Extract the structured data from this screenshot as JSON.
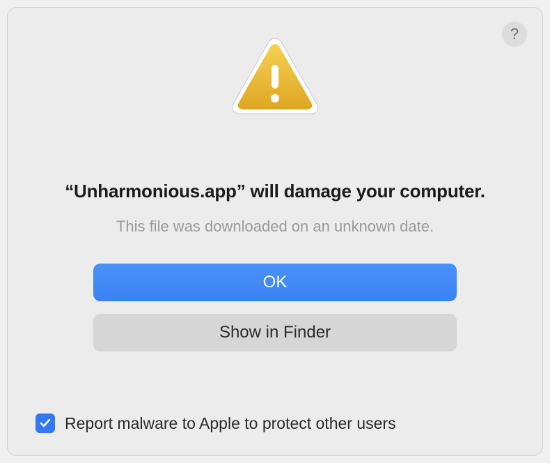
{
  "help_button": "?",
  "heading": "“Unharmonious.app” will damage your computer.",
  "subtext": "This file was downloaded on an unknown date.",
  "ok_label": "OK",
  "finder_label": "Show in Finder",
  "checkbox_checked": true,
  "checkbox_label": "Report malware to Apple to protect other users",
  "icons": {
    "warning": "warning-triangle",
    "help": "question-mark",
    "check": "checkmark"
  }
}
